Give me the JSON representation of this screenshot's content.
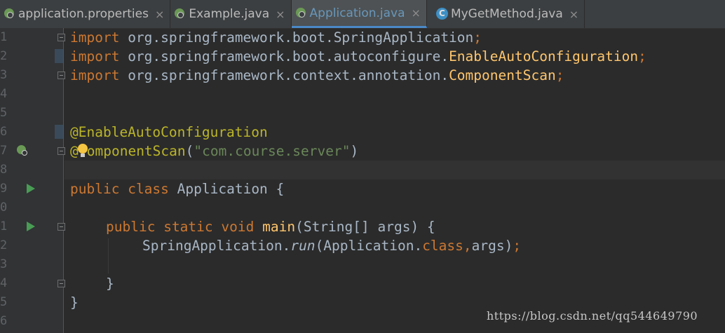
{
  "tabs": [
    {
      "label": "application.properties",
      "close": "×",
      "icon": "spring-config-icon",
      "active": false
    },
    {
      "label": "Example.java",
      "close": "×",
      "icon": "spring-class-icon",
      "active": false
    },
    {
      "label": "Application.java",
      "close": "×",
      "icon": "spring-class-icon",
      "active": true
    },
    {
      "label": "MyGetMethod.java",
      "close": "×",
      "icon": "class-icon",
      "active": false
    }
  ],
  "line_numbers": [
    "1",
    "2",
    "3",
    "4",
    "5",
    "6",
    "7",
    "8",
    "9",
    "0",
    "1",
    "2",
    "3",
    "4",
    "5",
    "6"
  ],
  "code": {
    "l1": {
      "kw": "import",
      "rest": " org.springframework.boot.SpringApplication",
      "semi": ";"
    },
    "l2": {
      "kw": "import",
      "rest": " org.springframework.boot.autoconfigure.",
      "cls": "EnableAutoConfiguration",
      "semi": ";"
    },
    "l3": {
      "kw": "import",
      "rest": " org.springframework.context.annotation.",
      "cls": "ComponentScan",
      "semi": ";"
    },
    "l6": {
      "anno": "@EnableAutoConfiguration"
    },
    "l7": {
      "anno_a": "@",
      "anno_b": "omponentScan",
      "open": "(",
      "str": "\"com.course.server\"",
      "close": ")"
    },
    "l9": {
      "kw1": "public",
      "kw2": "class",
      "name": "Application",
      "brace": "{"
    },
    "l11": {
      "kw1": "public",
      "kw2": "static",
      "kw3": "void",
      "fn": "main",
      "params": "(String[] args) {"
    },
    "l12": {
      "obj": "SpringApplication.",
      "call": "run",
      "args_a": "(Application.",
      "kw": "class",
      "comma": ",",
      "args_b": "args)",
      "semi": ";"
    },
    "l14": {
      "brace": "}"
    },
    "l15": {
      "brace": "}"
    }
  },
  "colors": {
    "background": "#2b2b2b",
    "keyword": "#cc7832",
    "annotation": "#bbb529",
    "string": "#6a8759",
    "method": "#ffc66d",
    "text": "#a9b7c6",
    "active_tab": "#6897bb"
  },
  "watermark": "https://blog.csdn.net/qq544649790"
}
